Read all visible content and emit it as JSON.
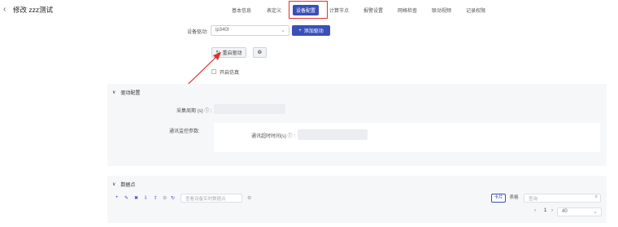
{
  "header": {
    "back_icon": "chevron-left-icon",
    "title": "修改 zzz测试",
    "tabs": [
      {
        "label": "基本信息",
        "active": false
      },
      {
        "label": "表定义",
        "active": false
      },
      {
        "label": "设备配置",
        "active": true
      },
      {
        "label": "计算节点",
        "active": false
      },
      {
        "label": "报警设置",
        "active": false
      },
      {
        "label": "网格检查",
        "active": false
      },
      {
        "label": "联动视频",
        "active": false
      },
      {
        "label": "记录权限",
        "active": false
      }
    ]
  },
  "driver": {
    "label": "设备驱动:",
    "value": "ip340t",
    "add_label": "添加驱动",
    "restart_label": "重启驱动",
    "simulate_label": "开启仿真"
  },
  "driver_config": {
    "title": "驱动配置",
    "collect_period_label": "采集周期 (s)",
    "monitor_params_label": "通讯监控参数:",
    "timeout_label": "通讯超时时间(s)"
  },
  "datapoints": {
    "title": "数据点",
    "filter_placeholder": "查看设备实时数据点",
    "view_card": "卡片",
    "view_table": "表格",
    "search_placeholder": "查询",
    "page": "1",
    "page_size": "40"
  },
  "colors": {
    "accent": "#3a4fb7",
    "highlight": "#e03030",
    "panel_bg": "#f6f7f9"
  }
}
